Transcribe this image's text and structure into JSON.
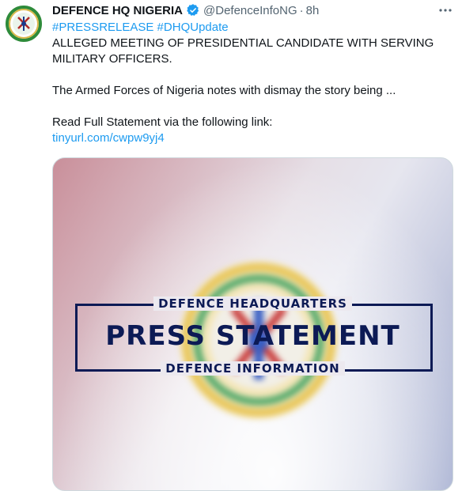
{
  "tweet": {
    "display_name": "DEFENCE HQ NIGERIA",
    "handle": "@DefenceInfoNG",
    "separator": "·",
    "time": "8h",
    "lines": {
      "hashtags": "#PRESSRELEASE #DHQUpdate",
      "headline_1": "ALLEGED MEETING OF PRESIDENTIAL CANDIDATE WITH SERVING",
      "headline_2": "MILITARY OFFICERS.",
      "body": "The Armed Forces of Nigeria notes with dismay the story being ...",
      "read_more": "Read Full Statement via the following link:",
      "link": "tinyurl.com/cwpw9yj4"
    }
  },
  "media": {
    "top_line": "DEFENCE HEADQUARTERS",
    "main_line": "PRESS STATEMENT",
    "bottom_line": "DEFENCE INFORMATION"
  },
  "icons": {
    "verified": "verified-badge-icon",
    "more": "more-options-icon",
    "avatar": "defence-hq-crest-icon"
  },
  "colors": {
    "link": "#1d9bf0",
    "statement_text": "#0c1a55",
    "verified": "#1d9bf0"
  }
}
